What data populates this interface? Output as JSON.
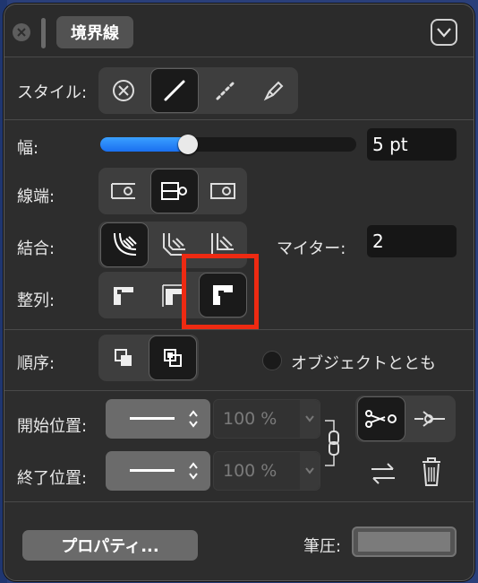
{
  "title": {
    "tab": "境界線"
  },
  "style_row": {
    "label": "スタイル:",
    "buttons": [
      "none-icon",
      "solid-line-icon",
      "dotted-line-icon",
      "brush-icon"
    ],
    "active": 1
  },
  "width_row": {
    "label": "幅:",
    "value": "5 pt",
    "slider_fraction": 0.33
  },
  "linecap_row": {
    "label": "線端:",
    "active": 1
  },
  "join_row": {
    "label": "結合:",
    "active": 0,
    "miter_label": "マイター:",
    "miter_value": "2"
  },
  "align_row": {
    "label": "整列:",
    "active": 2
  },
  "order_row": {
    "label": "順序:",
    "active": 1,
    "with_object_label": "オブジェクトととも"
  },
  "start_row": {
    "label": "開始位置:",
    "percent": "100 %"
  },
  "end_row": {
    "label": "終了位置:",
    "percent": "100 %"
  },
  "bottom": {
    "properties_button": "プロパティ...",
    "pressure_label": "筆圧:"
  },
  "colors": {
    "accent": "#1a6ff0",
    "highlight": "#ee2a12",
    "panel": "#2d2d2d"
  }
}
